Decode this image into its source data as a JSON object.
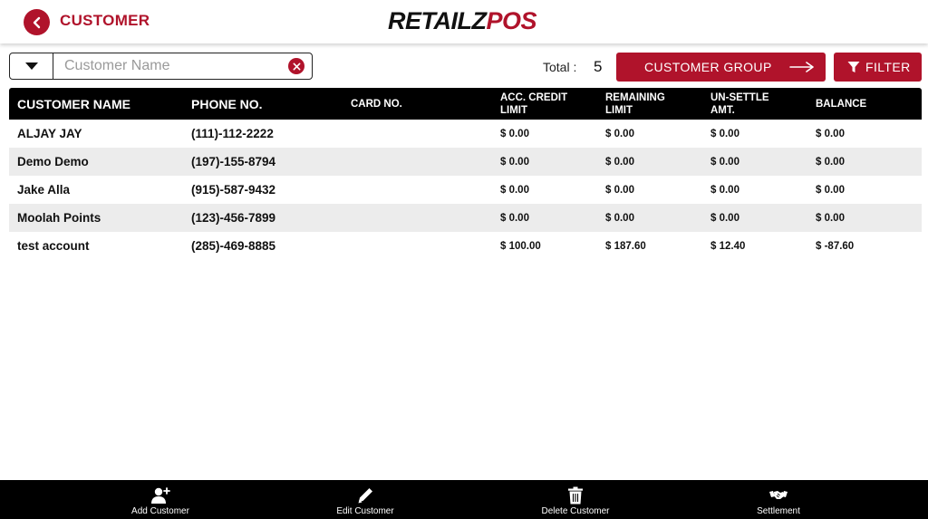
{
  "header": {
    "title": "CUSTOMER",
    "brand_part1": "RETAILZ",
    "brand_part2": "POS"
  },
  "search": {
    "placeholder": "Customer Name",
    "value": ""
  },
  "total": {
    "label": "Total :",
    "value": "5"
  },
  "buttons": {
    "customer_group": "CUSTOMER GROUP",
    "filter": "FILTER"
  },
  "table": {
    "columns": [
      "CUSTOMER NAME",
      "PHONE NO.",
      "CARD NO.",
      "ACC. CREDIT LIMIT",
      "REMAINING LIMIT",
      "UN-SETTLE AMT.",
      "BALANCE"
    ],
    "rows": [
      [
        "ALJAY JAY",
        "(111)-112-2222",
        "",
        "$ 0.00",
        "$ 0.00",
        "$ 0.00",
        "$ 0.00"
      ],
      [
        "Demo Demo",
        "(197)-155-8794",
        "",
        "$ 0.00",
        "$ 0.00",
        "$ 0.00",
        "$ 0.00"
      ],
      [
        "Jake Alla",
        "(915)-587-9432",
        "",
        "$ 0.00",
        "$ 0.00",
        "$ 0.00",
        "$ 0.00"
      ],
      [
        "Moolah Points",
        "(123)-456-7899",
        "",
        "$ 0.00",
        "$ 0.00",
        "$ 0.00",
        "$ 0.00"
      ],
      [
        "test account",
        "(285)-469-8885",
        "",
        "$ 100.00",
        "$ 187.60",
        "$ 12.40",
        "$ -87.60"
      ]
    ]
  },
  "footer": {
    "items": [
      {
        "label": "Add Customer",
        "icon": "add-user-icon"
      },
      {
        "label": "Edit Customer",
        "icon": "pencil-icon"
      },
      {
        "label": "Delete Customer",
        "icon": "trash-icon"
      },
      {
        "label": "Settlement",
        "icon": "handshake-icon"
      }
    ]
  },
  "colors": {
    "accent": "#b0132b",
    "header_row": "#000000",
    "alt_row": "#ececec"
  }
}
